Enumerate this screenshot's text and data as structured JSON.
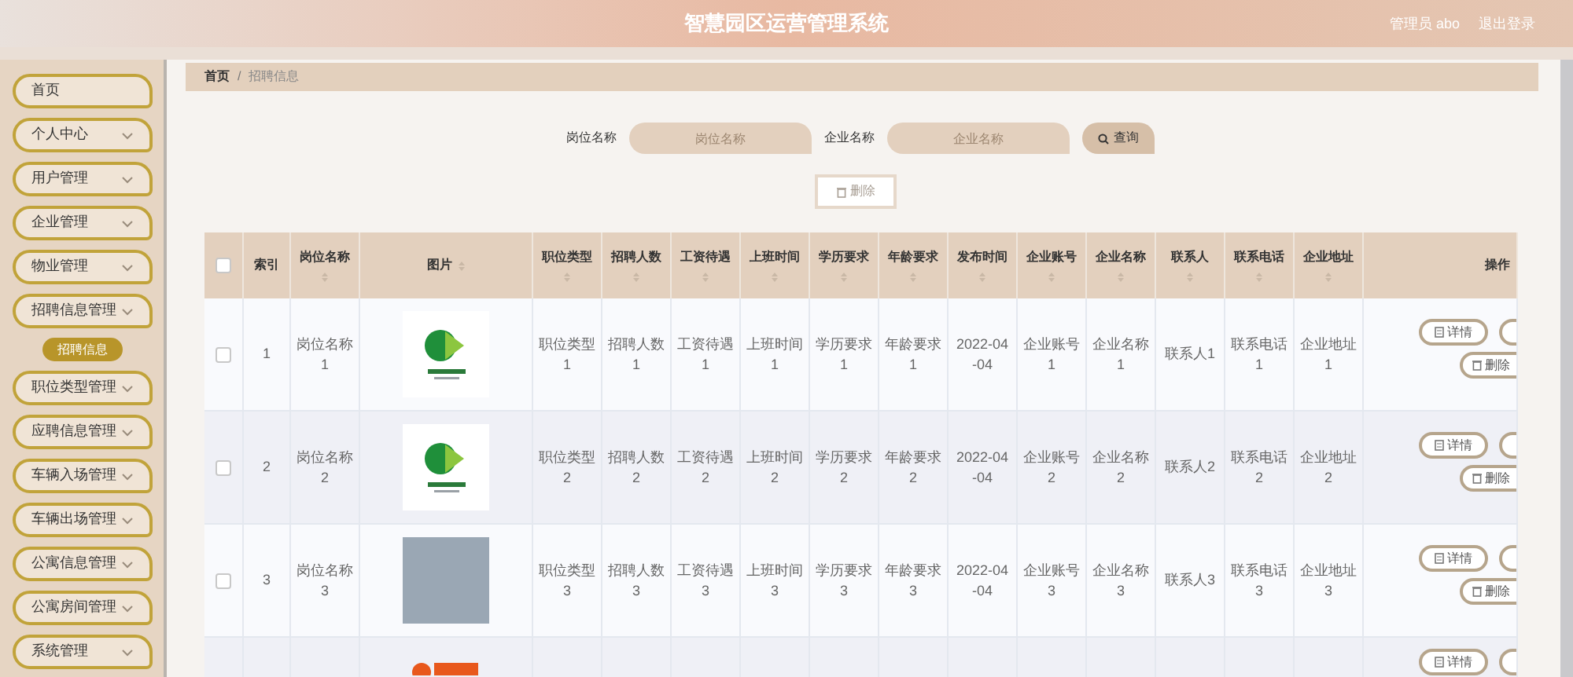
{
  "header": {
    "title": "智慧园区运营管理系统",
    "user": "管理员 abo",
    "logout": "退出登录"
  },
  "sidebar": {
    "items": [
      {
        "label": "首页",
        "kind": "link",
        "selected": false
      },
      {
        "label": "个人中心",
        "kind": "menu",
        "selected": false
      },
      {
        "label": "用户管理",
        "kind": "menu",
        "selected": false
      },
      {
        "label": "企业管理",
        "kind": "menu",
        "selected": false
      },
      {
        "label": "物业管理",
        "kind": "menu",
        "selected": false
      },
      {
        "label": "招聘信息管理",
        "kind": "menu",
        "selected": false,
        "children": [
          {
            "label": "招聘信息",
            "selected": true
          }
        ]
      },
      {
        "label": "职位类型管理",
        "kind": "menu",
        "selected": false
      },
      {
        "label": "应聘信息管理",
        "kind": "menu",
        "selected": false
      },
      {
        "label": "车辆入场管理",
        "kind": "menu",
        "selected": false
      },
      {
        "label": "车辆出场管理",
        "kind": "menu",
        "selected": false
      },
      {
        "label": "公寓信息管理",
        "kind": "menu",
        "selected": false
      },
      {
        "label": "公寓房间管理",
        "kind": "menu",
        "selected": false
      },
      {
        "label": "系统管理",
        "kind": "menu",
        "selected": false
      }
    ]
  },
  "breadcrumb": {
    "items": [
      "首页",
      "招聘信息"
    ],
    "separator": "/"
  },
  "search": {
    "fields": [
      {
        "label": "岗位名称",
        "placeholder": "岗位名称"
      },
      {
        "label": "企业名称",
        "placeholder": "企业名称"
      }
    ],
    "button": "查询"
  },
  "delete_button": {
    "label": "删除",
    "disabled": true
  },
  "table": {
    "all_selected": false,
    "columns": [
      {
        "kind": "checkbox"
      },
      {
        "kind": "index",
        "label": "索引"
      },
      {
        "kind": "text",
        "label": "岗位名称"
      },
      {
        "kind": "image",
        "label": "图片"
      },
      {
        "kind": "text",
        "label": "职位类型"
      },
      {
        "kind": "text",
        "label": "招聘人数"
      },
      {
        "kind": "text",
        "label": "工资待遇"
      },
      {
        "kind": "text",
        "label": "上班时间"
      },
      {
        "kind": "text",
        "label": "学历要求"
      },
      {
        "kind": "text",
        "label": "年龄要求"
      },
      {
        "kind": "date",
        "label": "发布时间"
      },
      {
        "kind": "text",
        "label": "企业账号"
      },
      {
        "kind": "text",
        "label": "企业名称"
      },
      {
        "kind": "text",
        "label": "联系人"
      },
      {
        "kind": "text",
        "label": "联系电话"
      },
      {
        "kind": "text",
        "label": "企业地址"
      },
      {
        "kind": "actions",
        "label": "操作"
      }
    ],
    "rows": [
      {
        "selected": false,
        "cut_off": false,
        "kind": "logo",
        "cells": [
          "1",
          "岗位名称1",
          "职位类型1",
          "招聘人数1",
          "工资待遇1",
          "上班时间1",
          "学历要求1",
          "年龄要求1",
          "2022-04-04",
          "企业账号1",
          "企业名称1",
          "联系人1",
          "联系电话1",
          "企业地址1"
        ],
        "actions": [
          "详情",
          "删除"
        ]
      },
      {
        "selected": false,
        "cut_off": false,
        "kind": "logo",
        "cells": [
          "2",
          "岗位名称2",
          "职位类型2",
          "招聘人数2",
          "工资待遇2",
          "上班时间2",
          "学历要求2",
          "年龄要求2",
          "2022-04-04",
          "企业账号2",
          "企业名称2",
          "联系人2",
          "联系电话2",
          "企业地址2"
        ],
        "actions": [
          "详情",
          "删除"
        ]
      },
      {
        "selected": false,
        "cut_off": false,
        "kind": "photo",
        "cells": [
          "3",
          "岗位名称3",
          "职位类型3",
          "招聘人数3",
          "工资待遇3",
          "上班时间3",
          "学历要求3",
          "年龄要求3",
          "2022-04-04",
          "企业账号3",
          "企业名称3",
          "联系人3",
          "联系电话3",
          "企业地址3"
        ],
        "actions": [
          "详情",
          "删除"
        ]
      },
      {
        "cut_off": true,
        "kind": "logo_orange",
        "actions": [
          "详情"
        ]
      }
    ]
  }
}
